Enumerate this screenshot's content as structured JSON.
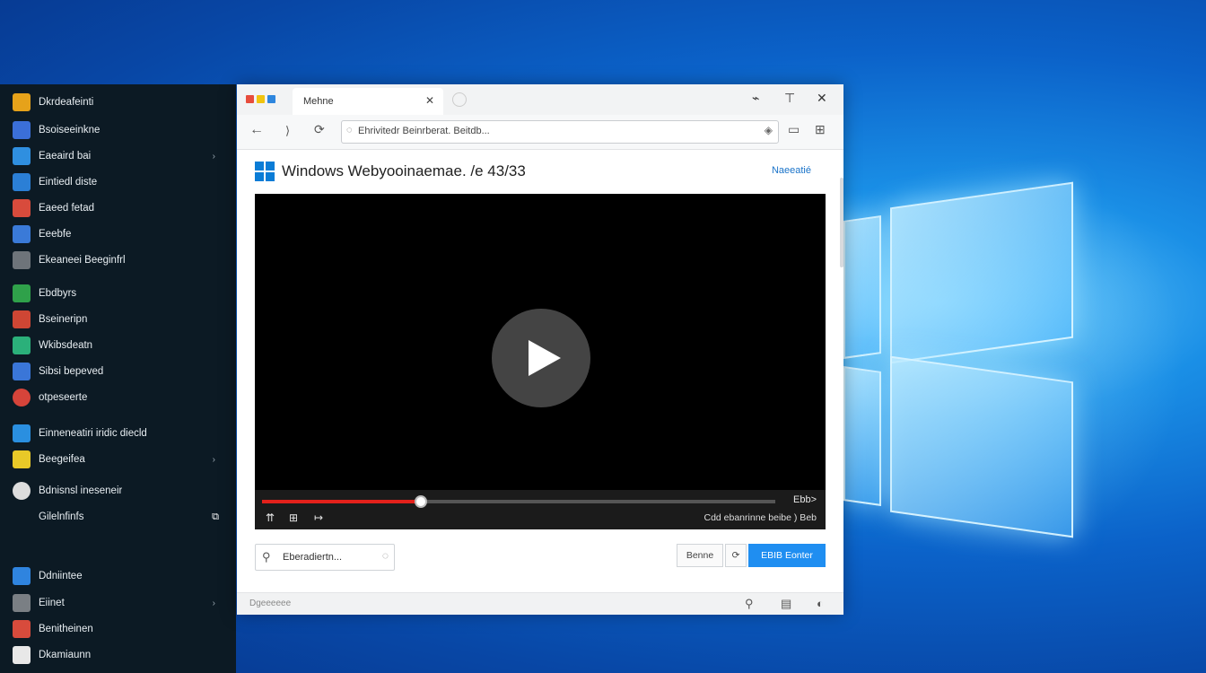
{
  "sidebar": {
    "items": [
      {
        "label": "Dkrdeafeinti",
        "icon": "app-icon-yellow",
        "color": "#e6a21a"
      },
      {
        "label": "Bsoiseeinkne",
        "icon": "app-icon-blue-star",
        "color": "#3b6fd8"
      },
      {
        "label": "Eaeaird bai",
        "icon": "app-icon-blue",
        "color": "#2f8fe0"
      },
      {
        "label": "Eintiedl diste",
        "icon": "app-icon-search",
        "color": "#2b7fd6"
      },
      {
        "label": "Eaeed fetad",
        "icon": "app-icon-doc",
        "color": "#d84b3c"
      },
      {
        "label": "Eeebfe",
        "icon": "app-icon-card",
        "color": "#3a7ad8"
      },
      {
        "label": "Ekeaneei Beeginfrl",
        "icon": "app-icon-gray",
        "color": "#6e747a"
      },
      {
        "label": "Ebdbyrs",
        "icon": "app-icon-green",
        "color": "#2fa14a"
      },
      {
        "label": "Bseineripn",
        "icon": "app-icon-red",
        "color": "#cf4634"
      },
      {
        "label": "Wkibsdeatn",
        "icon": "app-icon-palm",
        "color": "#2bb07a"
      },
      {
        "label": "Sibsi bepeved",
        "icon": "app-icon-blue-grid",
        "color": "#3a76d8"
      },
      {
        "label": "otpeseerte",
        "icon": "app-icon-red-circle",
        "color": "#d6443a"
      },
      {
        "label": "Einneneatiri iridic diecld",
        "icon": "app-icon-check",
        "color": "#2a8fe0"
      },
      {
        "label": "Beegeifea",
        "icon": "app-icon-yellow-note",
        "color": "#e8c928"
      },
      {
        "label": "Bdnisnsl ineseneir",
        "icon": "app-icon-white-circle",
        "color": "#dddddd"
      },
      {
        "label": "Gilelnfinfs",
        "icon": "",
        "color": ""
      },
      {
        "label": "Ddniintee",
        "icon": "app-icon-blue-o",
        "color": "#2f84df"
      },
      {
        "label": "Eiinet",
        "icon": "app-icon-gray-bars",
        "color": "#7a7f84"
      },
      {
        "label": "Benitheinen",
        "icon": "app-icon-red-blue",
        "color": "#d84b3c"
      },
      {
        "label": "Dkamiaunn",
        "icon": "app-icon-paper",
        "color": "#e8e8e8"
      }
    ],
    "arrow": "›",
    "badge": "⧉"
  },
  "browser": {
    "tab_title": "Mehne",
    "tab_close": "✕",
    "controls": {
      "minimize": "⌁",
      "pin": "⊤",
      "close": "✕"
    },
    "nav": {
      "back": "←",
      "forward": "⟩",
      "refresh": "⟳"
    },
    "address": "Ehrivitedr Beinrberat. Beitdb...",
    "address_icon": "◌",
    "address_end": "◈",
    "toolbar_icons": [
      "▭",
      "⊞"
    ],
    "page_title": "Windows Webyooinaemae. /e 43/33",
    "page_link": "Naeeatié",
    "video": {
      "progress": 0.31,
      "time": "Cdd ebanrinne beibe ) Beb",
      "fullscreen": "Ebb>",
      "ctl_labels": [
        "⇈",
        "⊞",
        "↦"
      ]
    },
    "search": {
      "text": "Eberadiertn...",
      "icon": "⚲",
      "end": "◌"
    },
    "buttons": {
      "secondary": "Benne",
      "icon": "⟳",
      "primary": "EBIB Eonter"
    },
    "status_text": "Dgeeeeee",
    "status_icons": [
      "⚲",
      "▤",
      "◐"
    ]
  },
  "colors": {
    "accent": "#1f8ef1",
    "progress": "#e3211b",
    "sidebar_bg": "#0c1a24"
  }
}
